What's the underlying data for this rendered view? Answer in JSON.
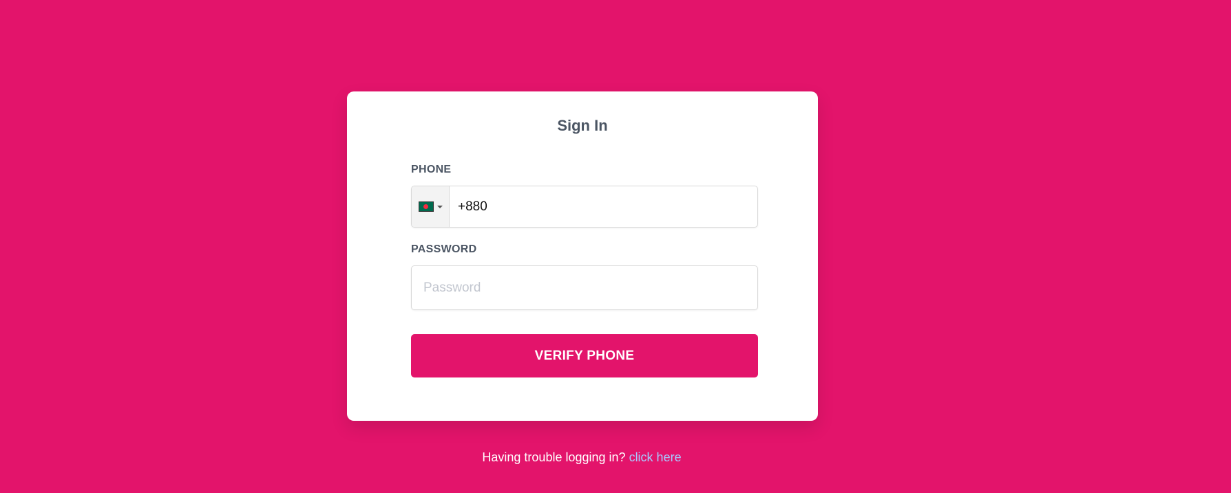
{
  "form": {
    "title": "Sign In",
    "phone_label": "PHONE",
    "phone_country_flag": "bangladesh-flag-icon",
    "phone_value": "+880",
    "password_label": "PASSWORD",
    "password_placeholder": "Password",
    "password_value": "",
    "submit_label": "VERIFY PHONE"
  },
  "footer": {
    "trouble_text": "Having trouble logging in?",
    "help_link": "click here"
  },
  "colors": {
    "background": "#e3146b",
    "card": "#ffffff",
    "button": "#e3146b",
    "link": "#a9c9ff",
    "label": "#4b5563"
  }
}
